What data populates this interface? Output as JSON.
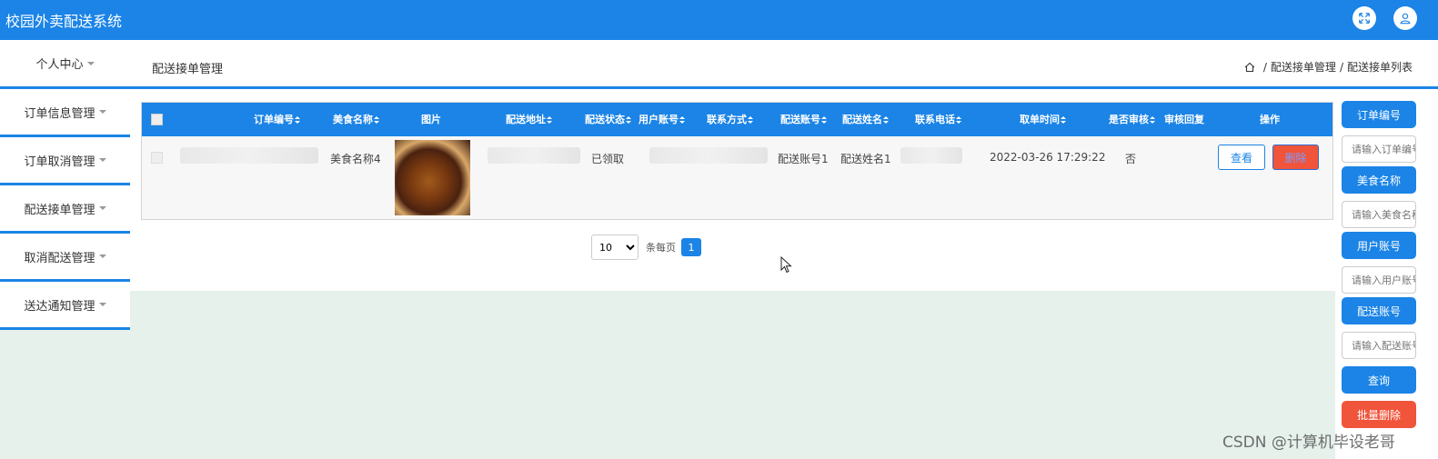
{
  "app": {
    "title": "校园外卖配送系统"
  },
  "sidebar": {
    "personal_center": "个人中心",
    "items": [
      {
        "label": "订单信息管理"
      },
      {
        "label": "订单取消管理"
      },
      {
        "label": "配送接单管理"
      },
      {
        "label": "取消配送管理"
      },
      {
        "label": "送达通知管理"
      }
    ]
  },
  "header": {
    "page_title": "配送接单管理",
    "breadcrumb": [
      "配送接单管理",
      "配送接单列表"
    ],
    "breadcrumb_sep": "/"
  },
  "table": {
    "columns": [
      "订单编号",
      "美食名称",
      "图片",
      "配送地址",
      "配送状态",
      "用户账号",
      "联系方式",
      "配送账号",
      "配送姓名",
      "联系电话",
      "取单时间",
      "是否审核",
      "审核回复",
      "操作"
    ],
    "rows": [
      {
        "food_name": "美食名称4",
        "status": "已领取",
        "delivery_account": "配送账号1",
        "delivery_name": "配送姓名1",
        "pickup_time": "2022-03-26 17:29:22",
        "reviewed": "否"
      }
    ],
    "view_label": "查看",
    "delete_label": "删除"
  },
  "pagination": {
    "page_size": "10",
    "per_page_label": "条每页",
    "current_page": "1"
  },
  "search": {
    "order_no_button": "订单编号",
    "order_no_placeholder": "请输入订单编号",
    "food_name_button": "美食名称",
    "food_name_placeholder": "请输入美食名称",
    "user_account_button": "用户账号",
    "user_account_placeholder": "请输入用户账号",
    "delivery_account_button": "配送账号",
    "delivery_account_placeholder": "请输入配送账号",
    "query_button": "查询",
    "batch_delete_button": "批量删除"
  },
  "watermark": "CSDN @计算机毕设老哥",
  "colors": {
    "primary": "#1b84e6",
    "danger": "#f0543a",
    "background": "#e6f1ec"
  }
}
